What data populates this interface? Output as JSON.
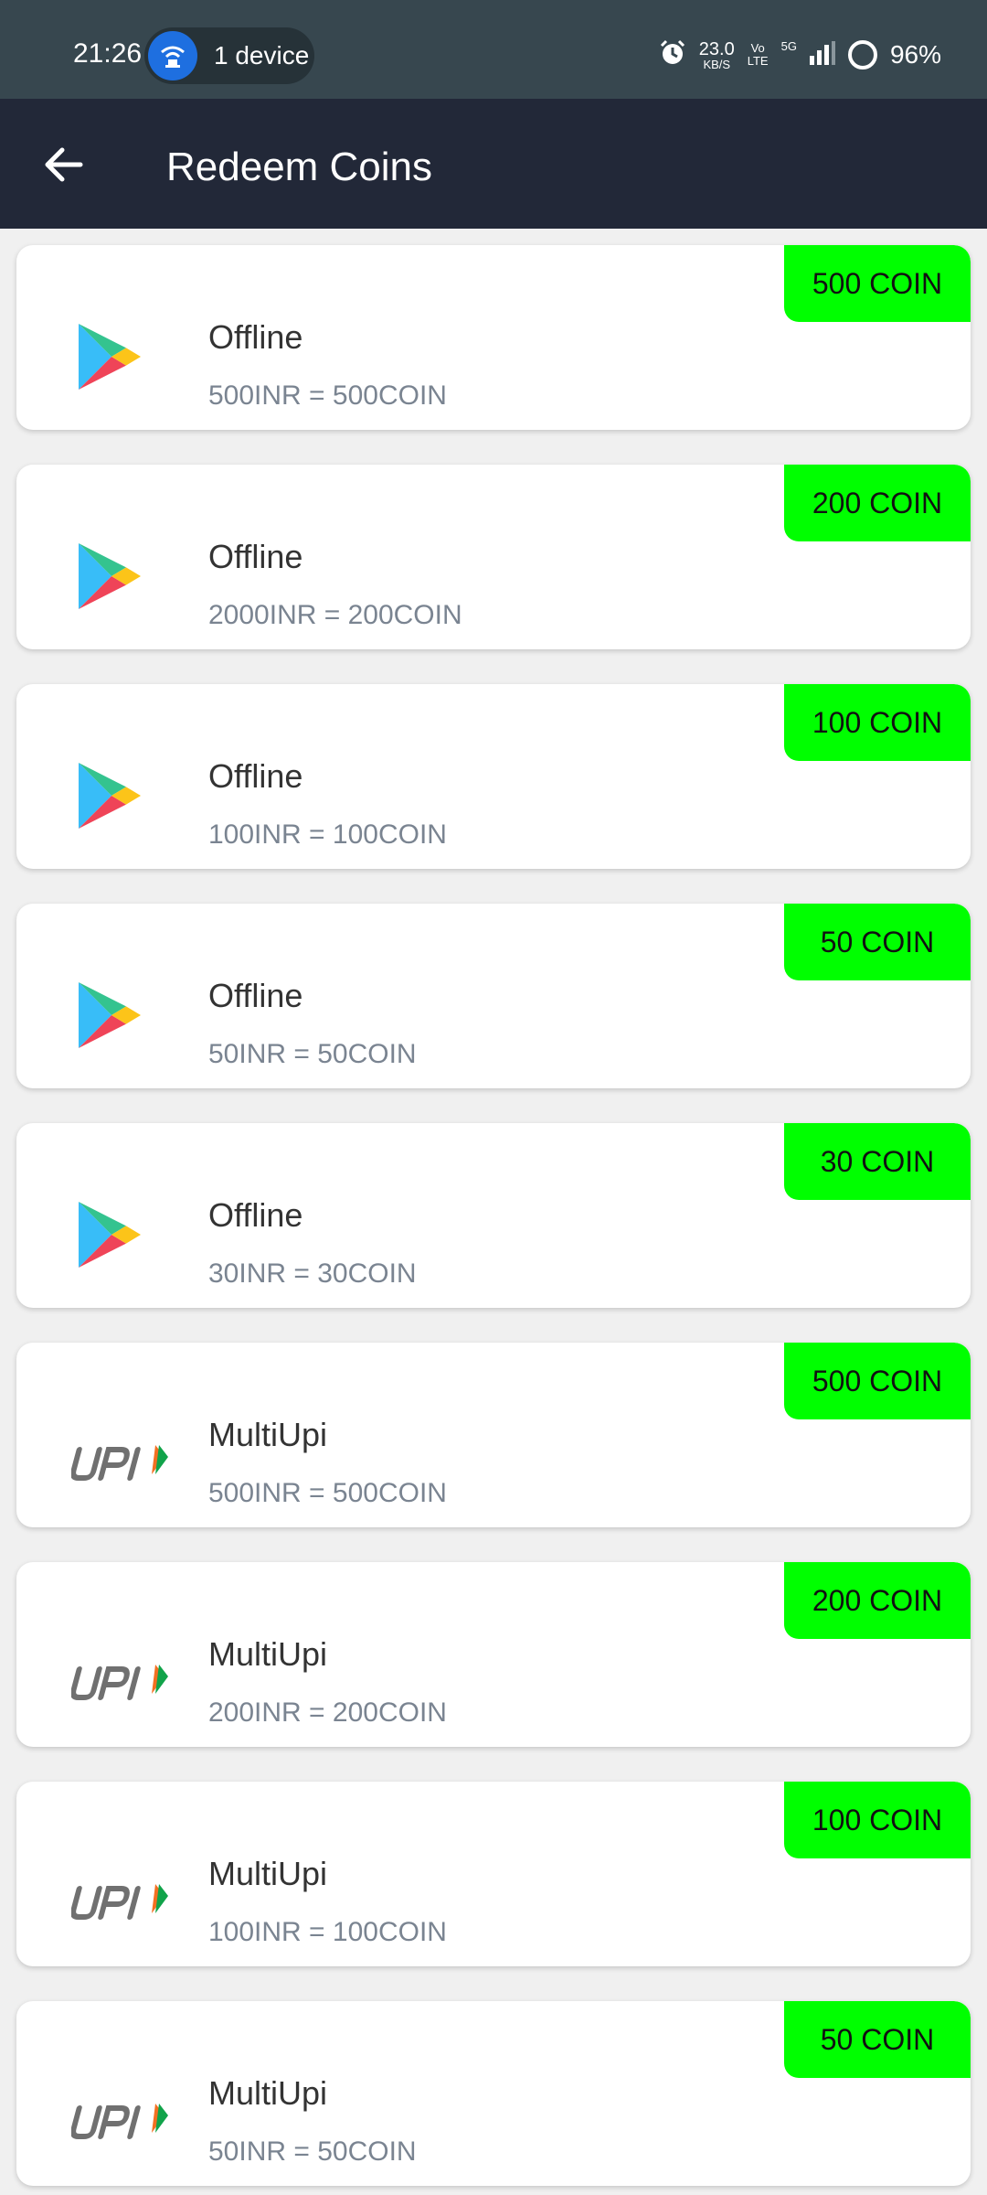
{
  "status_bar": {
    "time": "21:26",
    "hotspot_label": "1 device",
    "net_speed_value": "23.0",
    "net_speed_unit": "KB/S",
    "volte_top": "Vo",
    "volte_bottom": "LTE",
    "network": "5G",
    "battery": "96%"
  },
  "app_bar": {
    "title": "Redeem Coins",
    "back_icon": "arrow-left-icon"
  },
  "colors": {
    "badge": "#00ff00",
    "app_bar": "#222838",
    "status_bar": "#37474f"
  },
  "items": [
    {
      "icon": "play-store-icon",
      "title": "Offline",
      "subtitle": "500INR = 500COIN",
      "badge": "500 COIN"
    },
    {
      "icon": "play-store-icon",
      "title": "Offline",
      "subtitle": "2000INR = 200COIN",
      "badge": "200 COIN"
    },
    {
      "icon": "play-store-icon",
      "title": "Offline",
      "subtitle": "100INR = 100COIN",
      "badge": "100 COIN"
    },
    {
      "icon": "play-store-icon",
      "title": "Offline",
      "subtitle": "50INR = 50COIN",
      "badge": "50 COIN"
    },
    {
      "icon": "play-store-icon",
      "title": "Offline",
      "subtitle": "30INR = 30COIN",
      "badge": "30 COIN"
    },
    {
      "icon": "upi-logo-icon",
      "title": "MultiUpi",
      "subtitle": "500INR = 500COIN",
      "badge": "500 COIN"
    },
    {
      "icon": "upi-logo-icon",
      "title": "MultiUpi",
      "subtitle": "200INR = 200COIN",
      "badge": "200 COIN"
    },
    {
      "icon": "upi-logo-icon",
      "title": "MultiUpi",
      "subtitle": "100INR = 100COIN",
      "badge": "100 COIN"
    },
    {
      "icon": "upi-logo-icon",
      "title": "MultiUpi",
      "subtitle": "50INR = 50COIN",
      "badge": "50 COIN"
    }
  ]
}
